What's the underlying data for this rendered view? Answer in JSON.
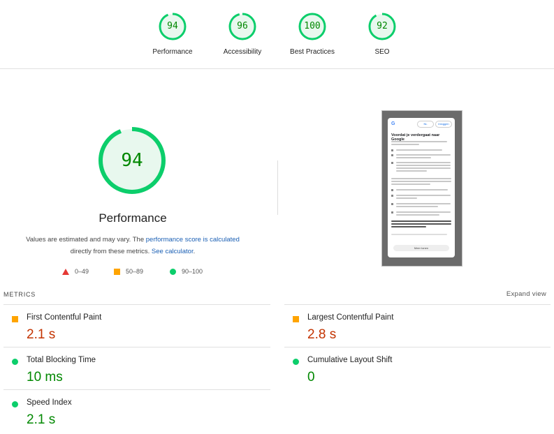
{
  "summary_gauges": [
    {
      "score": "94",
      "label": "Performance"
    },
    {
      "score": "96",
      "label": "Accessibility"
    },
    {
      "score": "100",
      "label": "Best Practices"
    },
    {
      "score": "92",
      "label": "SEO"
    }
  ],
  "performance": {
    "score": "94",
    "title": "Performance",
    "desc_part1": "Values are estimated and may vary. The ",
    "desc_link1": "performance score is calculated",
    "desc_part2": "directly from these metrics. ",
    "desc_link2": "See calculator",
    "desc_end": "."
  },
  "legend": [
    {
      "range": "0–49",
      "shape": "triangle",
      "color": "#e53935"
    },
    {
      "range": "50–89",
      "shape": "square",
      "color": "#ffa400"
    },
    {
      "range": "90–100",
      "shape": "circle",
      "color": "#0cce6b"
    }
  ],
  "screenshot": {
    "brand": "G",
    "lang_pill": "NL",
    "signin_pill": "Inloggen",
    "heading": "Voordat je verdergaat naar Google",
    "button": "Meer tonen"
  },
  "metrics": {
    "header": "METRICS",
    "expand_label": "Expand view",
    "items": [
      {
        "name": "First Contentful Paint",
        "value": "2.1 s",
        "rating": "average"
      },
      {
        "name": "Largest Contentful Paint",
        "value": "2.8 s",
        "rating": "average"
      },
      {
        "name": "Total Blocking Time",
        "value": "10 ms",
        "rating": "good"
      },
      {
        "name": "Cumulative Layout Shift",
        "value": "0",
        "rating": "good"
      },
      {
        "name": "Speed Index",
        "value": "2.1 s",
        "rating": "good"
      }
    ]
  },
  "colors": {
    "good": "#0cce6b",
    "good_text": "#008800",
    "average": "#ffa400",
    "average_text": "#c33300",
    "poor": "#e53935",
    "link": "#1a5fb4"
  }
}
